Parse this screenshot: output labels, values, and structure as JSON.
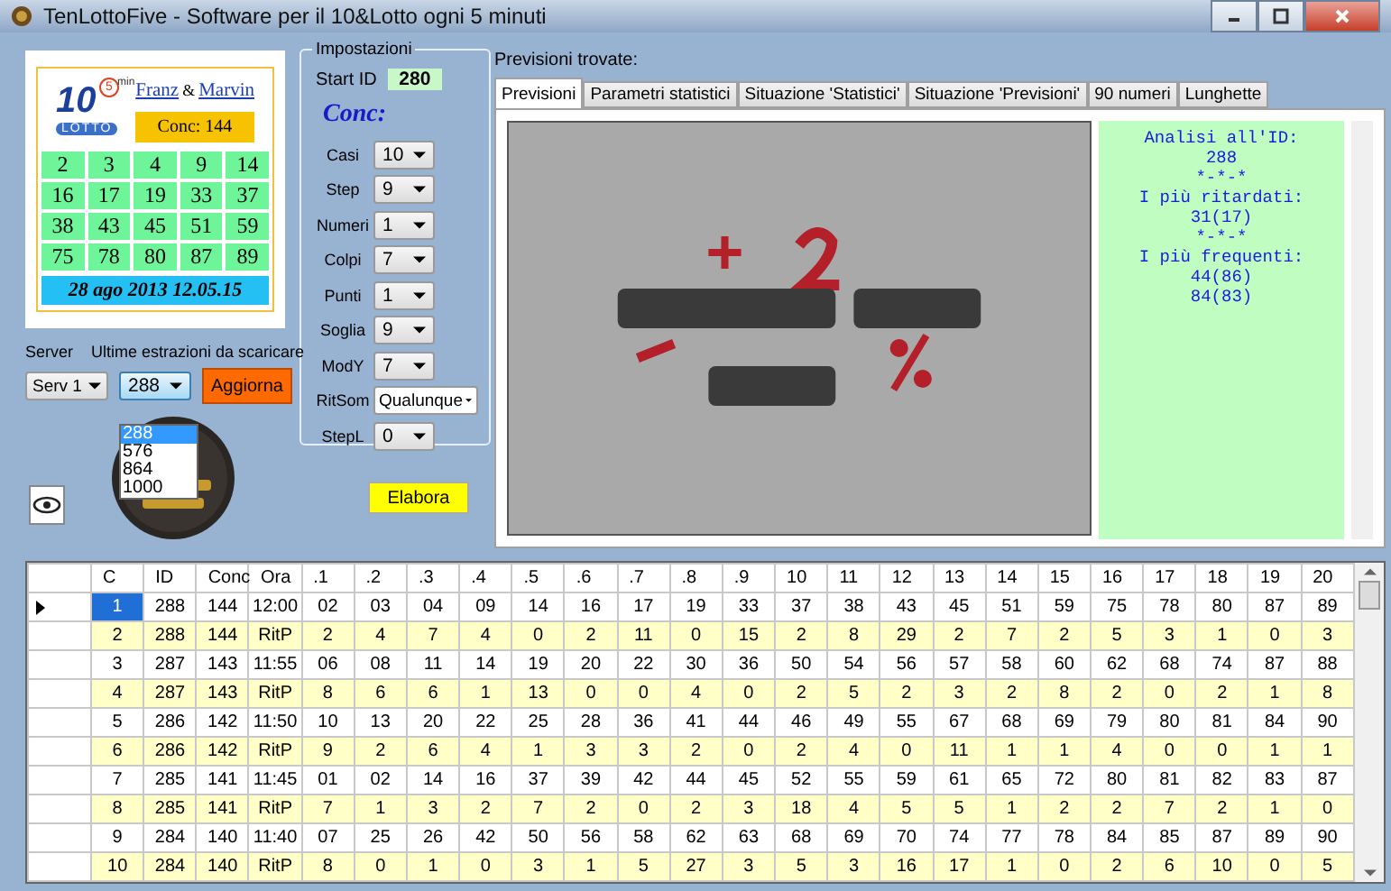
{
  "window": {
    "title": "TenLottoFive - Software per il 10&Lotto ogni 5 minuti"
  },
  "logo": {
    "number": "10",
    "minutes": "5",
    "unit": "min",
    "name": "LOTTO"
  },
  "authors": {
    "first": "Franz",
    "separator": "&",
    "second": "Marvin"
  },
  "conc_badge": "Conc: 144",
  "numbers": [
    "2",
    "3",
    "4",
    "9",
    "14",
    "16",
    "17",
    "19",
    "33",
    "37",
    "38",
    "43",
    "45",
    "51",
    "59",
    "75",
    "78",
    "80",
    "87",
    "89"
  ],
  "date": "28 ago 2013 12.05.15",
  "server": {
    "label": "Server",
    "value": "Serv 1"
  },
  "download": {
    "label": "Ultime estrazioni da scaricare",
    "value": "288",
    "expanded": true,
    "options": [
      {
        "label": "288",
        "selected": true
      },
      {
        "label": "576",
        "selected": false
      },
      {
        "label": "864",
        "selected": false
      },
      {
        "label": "1000",
        "selected": false
      }
    ]
  },
  "update_button": "Aggiorna",
  "settings": {
    "title": "Impostazioni",
    "start_id_label": "Start ID",
    "start_id": "280",
    "heading": "Conc:",
    "fields": [
      {
        "label": "Casi",
        "value": "10",
        "kind": "narrow"
      },
      {
        "label": "Step",
        "value": "9",
        "kind": "narrow"
      },
      {
        "label": "Numeri",
        "value": "1",
        "kind": "narrow"
      },
      {
        "label": "Colpi",
        "value": "7",
        "kind": "narrow"
      },
      {
        "label": "Punti",
        "value": "1",
        "kind": "narrow"
      },
      {
        "label": "Soglia",
        "value": "9",
        "kind": "narrow"
      },
      {
        "label": "ModY",
        "value": "7",
        "kind": "narrow"
      },
      {
        "label": "RitSom",
        "value": "Qualunque",
        "kind": "wide"
      },
      {
        "label": "StepL",
        "value": "0",
        "kind": "narrow"
      }
    ]
  },
  "run_button": "Elabora",
  "results": {
    "label": "Previsioni trovate:",
    "tabs": [
      {
        "label": "Previsioni",
        "selected": true
      },
      {
        "label": "Parametri statistici",
        "selected": false
      },
      {
        "label": "Situazione 'Statistici'",
        "selected": false
      },
      {
        "label": "Situazione 'Previsioni'",
        "selected": false
      },
      {
        "label": "90 numeri",
        "selected": false
      },
      {
        "label": "Lunghette",
        "selected": false
      }
    ],
    "analysis": [
      "Analisi all'ID:",
      "288",
      "*-*-*",
      "I più ritardati:",
      "31(17)",
      "*-*-*",
      "I più frequenti:",
      "44(86)",
      "84(83)"
    ]
  },
  "table": {
    "columns": [
      "C",
      "ID",
      "Conc",
      "Ora",
      ".1",
      ".2",
      ".3",
      ".4",
      ".5",
      ".6",
      ".7",
      ".8",
      ".9",
      "10",
      "11",
      "12",
      "13",
      "14",
      "15",
      "16",
      "17",
      "18",
      "19",
      "20"
    ],
    "rows": [
      {
        "kind": "draw",
        "selected": true,
        "cells": [
          "1",
          "288",
          "144",
          "12:00",
          "02",
          "03",
          "04",
          "09",
          "14",
          "16",
          "17",
          "19",
          "33",
          "37",
          "38",
          "43",
          "45",
          "51",
          "59",
          "75",
          "78",
          "80",
          "87",
          "89"
        ]
      },
      {
        "kind": "delay",
        "selected": false,
        "cells": [
          "2",
          "288",
          "144",
          "RitP",
          "2",
          "4",
          "7",
          "4",
          "0",
          "2",
          "11",
          "0",
          "15",
          "2",
          "8",
          "29",
          "2",
          "7",
          "2",
          "5",
          "3",
          "1",
          "0",
          "3"
        ]
      },
      {
        "kind": "draw",
        "selected": false,
        "cells": [
          "3",
          "287",
          "143",
          "11:55",
          "06",
          "08",
          "11",
          "14",
          "19",
          "20",
          "22",
          "30",
          "36",
          "50",
          "54",
          "56",
          "57",
          "58",
          "60",
          "62",
          "68",
          "74",
          "87",
          "88"
        ]
      },
      {
        "kind": "delay",
        "selected": false,
        "cells": [
          "4",
          "287",
          "143",
          "RitP",
          "8",
          "6",
          "6",
          "1",
          "13",
          "0",
          "0",
          "4",
          "0",
          "2",
          "5",
          "2",
          "3",
          "2",
          "8",
          "2",
          "0",
          "2",
          "1",
          "8"
        ]
      },
      {
        "kind": "draw",
        "selected": false,
        "cells": [
          "5",
          "286",
          "142",
          "11:50",
          "10",
          "13",
          "20",
          "22",
          "25",
          "28",
          "36",
          "41",
          "44",
          "46",
          "49",
          "55",
          "67",
          "68",
          "69",
          "79",
          "80",
          "81",
          "84",
          "90"
        ]
      },
      {
        "kind": "delay",
        "selected": false,
        "cells": [
          "6",
          "286",
          "142",
          "RitP",
          "9",
          "2",
          "6",
          "4",
          "1",
          "3",
          "3",
          "2",
          "0",
          "2",
          "4",
          "0",
          "11",
          "1",
          "1",
          "4",
          "0",
          "0",
          "1",
          "1"
        ]
      },
      {
        "kind": "draw",
        "selected": false,
        "cells": [
          "7",
          "285",
          "141",
          "11:45",
          "01",
          "02",
          "14",
          "16",
          "37",
          "39",
          "42",
          "44",
          "45",
          "52",
          "55",
          "59",
          "61",
          "65",
          "72",
          "80",
          "81",
          "82",
          "83",
          "87"
        ]
      },
      {
        "kind": "delay",
        "selected": false,
        "cells": [
          "8",
          "285",
          "141",
          "RitP",
          "7",
          "1",
          "3",
          "2",
          "7",
          "2",
          "0",
          "2",
          "3",
          "18",
          "4",
          "5",
          "5",
          "1",
          "2",
          "2",
          "7",
          "2",
          "1",
          "0"
        ]
      },
      {
        "kind": "draw",
        "selected": false,
        "cells": [
          "9",
          "284",
          "140",
          "11:40",
          "07",
          "25",
          "26",
          "42",
          "50",
          "56",
          "58",
          "62",
          "63",
          "68",
          "69",
          "70",
          "74",
          "77",
          "78",
          "84",
          "85",
          "87",
          "89",
          "90"
        ]
      },
      {
        "kind": "delay",
        "selected": false,
        "cells": [
          "10",
          "284",
          "140",
          "RitP",
          "8",
          "0",
          "1",
          "0",
          "3",
          "1",
          "5",
          "27",
          "3",
          "5",
          "3",
          "16",
          "17",
          "1",
          "0",
          "2",
          "6",
          "10",
          "0",
          "5"
        ]
      }
    ]
  }
}
